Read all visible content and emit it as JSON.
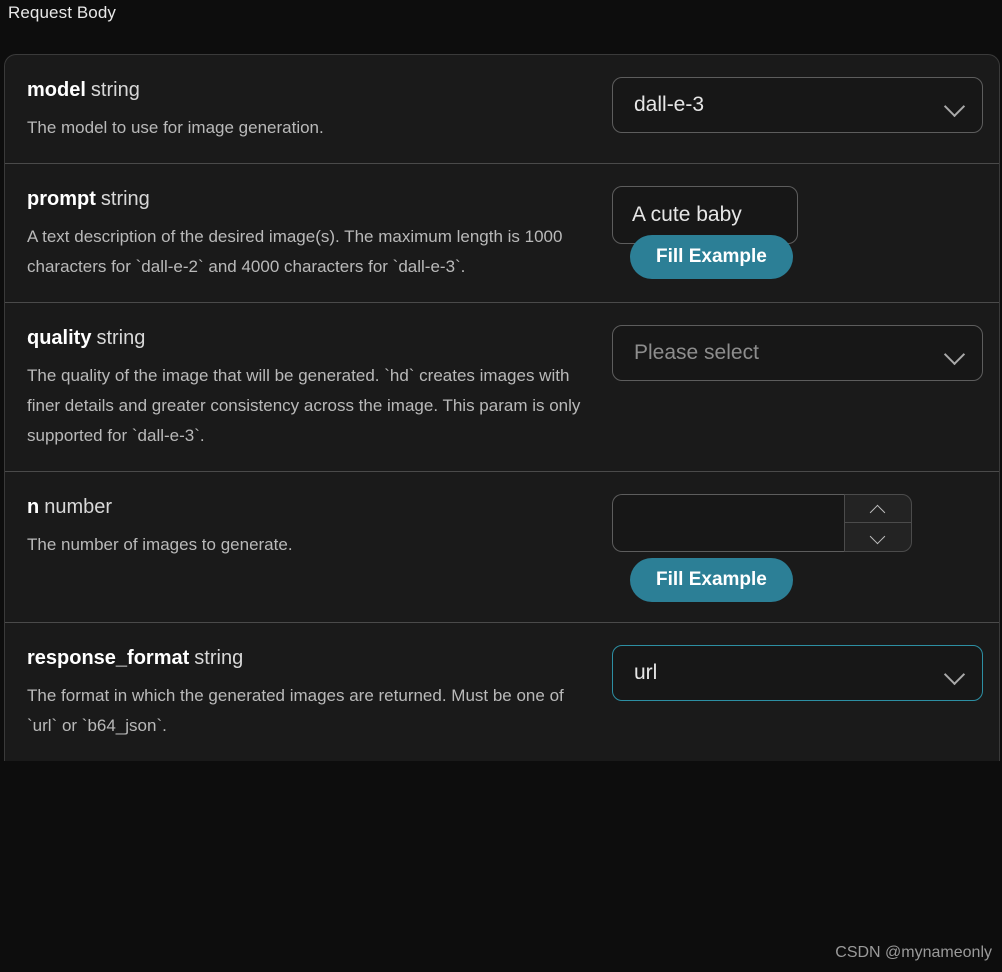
{
  "header": {
    "title": "Request Body"
  },
  "params": [
    {
      "name": "model",
      "type": "string",
      "description": "The model to use for image generation.",
      "control": "select",
      "value": "dall-e-3",
      "is_placeholder": false,
      "focused": false,
      "icon": "chevron-down-icon"
    },
    {
      "name": "prompt",
      "type": "string",
      "description": "A text description of the desired image(s). The maximum length is 1000 characters for `dall-e-2` and 4000 characters for `dall-e-3`.",
      "control": "text",
      "value": "A cute baby",
      "placeholder": "",
      "fill_example_label": "Fill Example"
    },
    {
      "name": "quality",
      "type": "string",
      "description": "The quality of the image that will be generated. `hd` creates images with finer details and greater consistency across the image. This param is only supported for `dall-e-3`.",
      "control": "select",
      "value": "Please select",
      "is_placeholder": true,
      "focused": false,
      "icon": "chevron-down-icon"
    },
    {
      "name": "n",
      "type": "number",
      "description": "The number of images to generate.",
      "control": "number",
      "value": "",
      "stepper_up_icon": "chevron-up-icon",
      "stepper_down_icon": "chevron-down-icon",
      "fill_example_label": "Fill Example"
    },
    {
      "name": "response_format",
      "type": "string",
      "description": "The format in which the generated images are returned. Must be one of `url` or `b64_json`.",
      "control": "select",
      "value": "url",
      "is_placeholder": false,
      "focused": true,
      "icon": "chevron-down-icon"
    }
  ],
  "watermark": "CSDN @mynameonly",
  "colors": {
    "page_background": "#0d0d0d",
    "card_background": "#1a1a1a",
    "accent_button": "#2c7f96",
    "focus_border": "#2d8fa3",
    "border": "#5d5d5d",
    "text_primary": "#ffffff",
    "text_secondary": "#b9b9b9",
    "placeholder": "#8d8d8d"
  }
}
